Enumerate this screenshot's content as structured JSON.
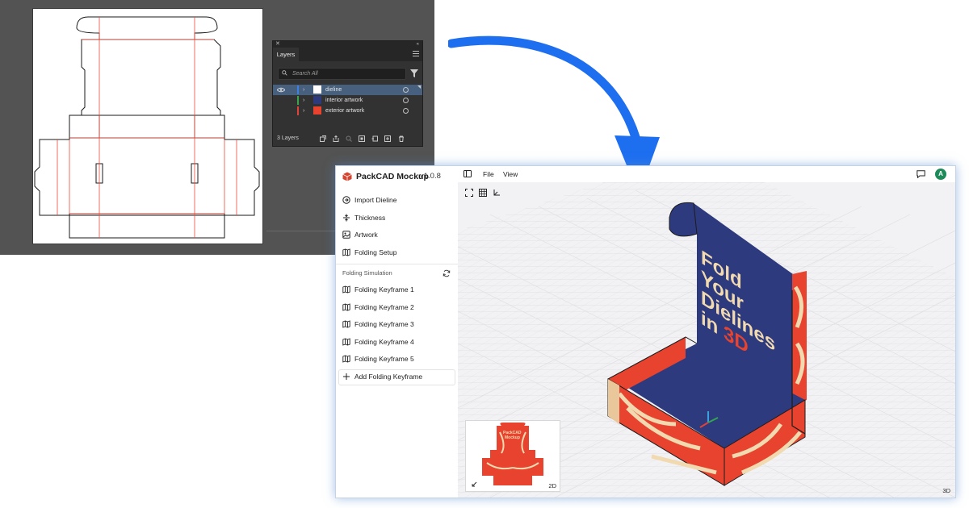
{
  "layers_panel": {
    "tab": "Layers",
    "search_placeholder": "Search All",
    "layers": [
      {
        "name": "dieline",
        "color": "#3f7fe0",
        "selected": true,
        "visible": true
      },
      {
        "name": "interior artwork",
        "color": "#3aa54a",
        "selected": false,
        "visible": false
      },
      {
        "name": "exterior artwork",
        "color": "#e0433a",
        "selected": false,
        "visible": false
      }
    ],
    "count_label": "3 Layers"
  },
  "app": {
    "name": "PackCAD Mockup",
    "version": "v1.0.8",
    "menu": {
      "file": "File",
      "view": "View"
    },
    "avatar_initial": "A",
    "sidebar": {
      "items": [
        {
          "label": "Import Dieline",
          "icon": "import-icon"
        },
        {
          "label": "Thickness",
          "icon": "thickness-icon"
        },
        {
          "label": "Artwork",
          "icon": "image-icon"
        },
        {
          "label": "Folding Setup",
          "icon": "map-icon"
        }
      ],
      "section_title": "Folding Simulation",
      "keyframes": [
        {
          "label": "Folding Keyframe 1",
          "icon": "map-icon"
        },
        {
          "label": "Folding Keyframe 2",
          "icon": "map-icon"
        },
        {
          "label": "Folding Keyframe 3",
          "icon": "map-icon"
        },
        {
          "label": "Folding Keyframe 4",
          "icon": "map-icon"
        },
        {
          "label": "Folding Keyframe 5",
          "icon": "map-icon"
        }
      ],
      "add_keyframe": "Add Folding Keyframe"
    },
    "viewport": {
      "box_text": [
        "Fold",
        "Your",
        "Dielines",
        "in 3D"
      ],
      "box_text_accent": "3D",
      "thumbnail_tag": "2D",
      "mode_tag": "3D",
      "thumb_text": [
        "PackCAD",
        "Mockup"
      ]
    },
    "colors": {
      "box_exterior": "#e8432f",
      "box_interior": "#2e3a7e",
      "accent_text": "#f1d9b0",
      "arrow": "#1e6ff0"
    }
  }
}
